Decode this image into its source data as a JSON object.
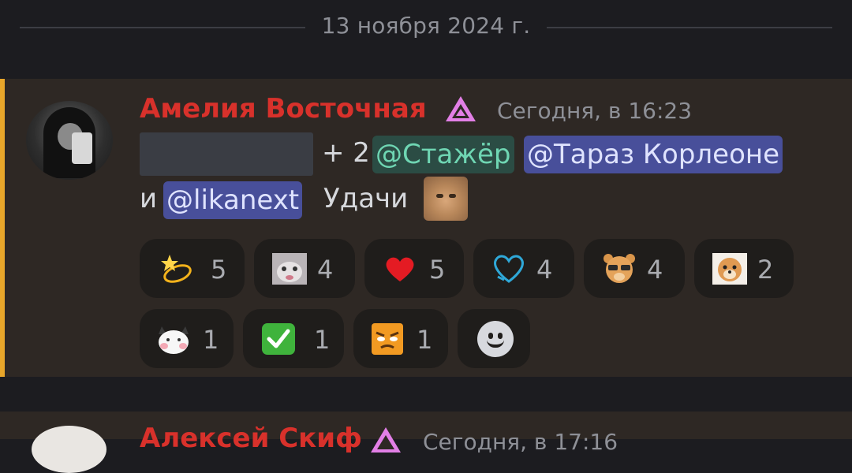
{
  "date_separator": "13 ноября 2024 г.",
  "message": {
    "author": "Амелия Восточная",
    "timestamp": "Сегодня, в 16:23",
    "text_plus": "+ 2",
    "mentions": [
      "@Стажёр",
      "@Тараз Корлеоне",
      "@likanext"
    ],
    "text_and": "и",
    "text_tail": "Удачи",
    "accent_color": "#e8a62a",
    "name_color": "#d8312b"
  },
  "reactions": [
    {
      "icon": "dizzy-star-icon",
      "count": "5"
    },
    {
      "icon": "crying-cat-icon",
      "count": "4"
    },
    {
      "icon": "red-heart-icon",
      "count": "5"
    },
    {
      "icon": "blue-heart-icon",
      "count": "4"
    },
    {
      "icon": "bear-sunglasses-icon",
      "count": "4"
    },
    {
      "icon": "pomeranian-dog-icon",
      "count": "2"
    },
    {
      "icon": "cat-blush-icon",
      "count": "1"
    },
    {
      "icon": "check-mark-icon",
      "count": "1"
    },
    {
      "icon": "angry-face-icon",
      "count": "1"
    }
  ],
  "next_message": {
    "author": "Алексей Скиф",
    "timestamp": "Сегодня, в 17:16"
  }
}
